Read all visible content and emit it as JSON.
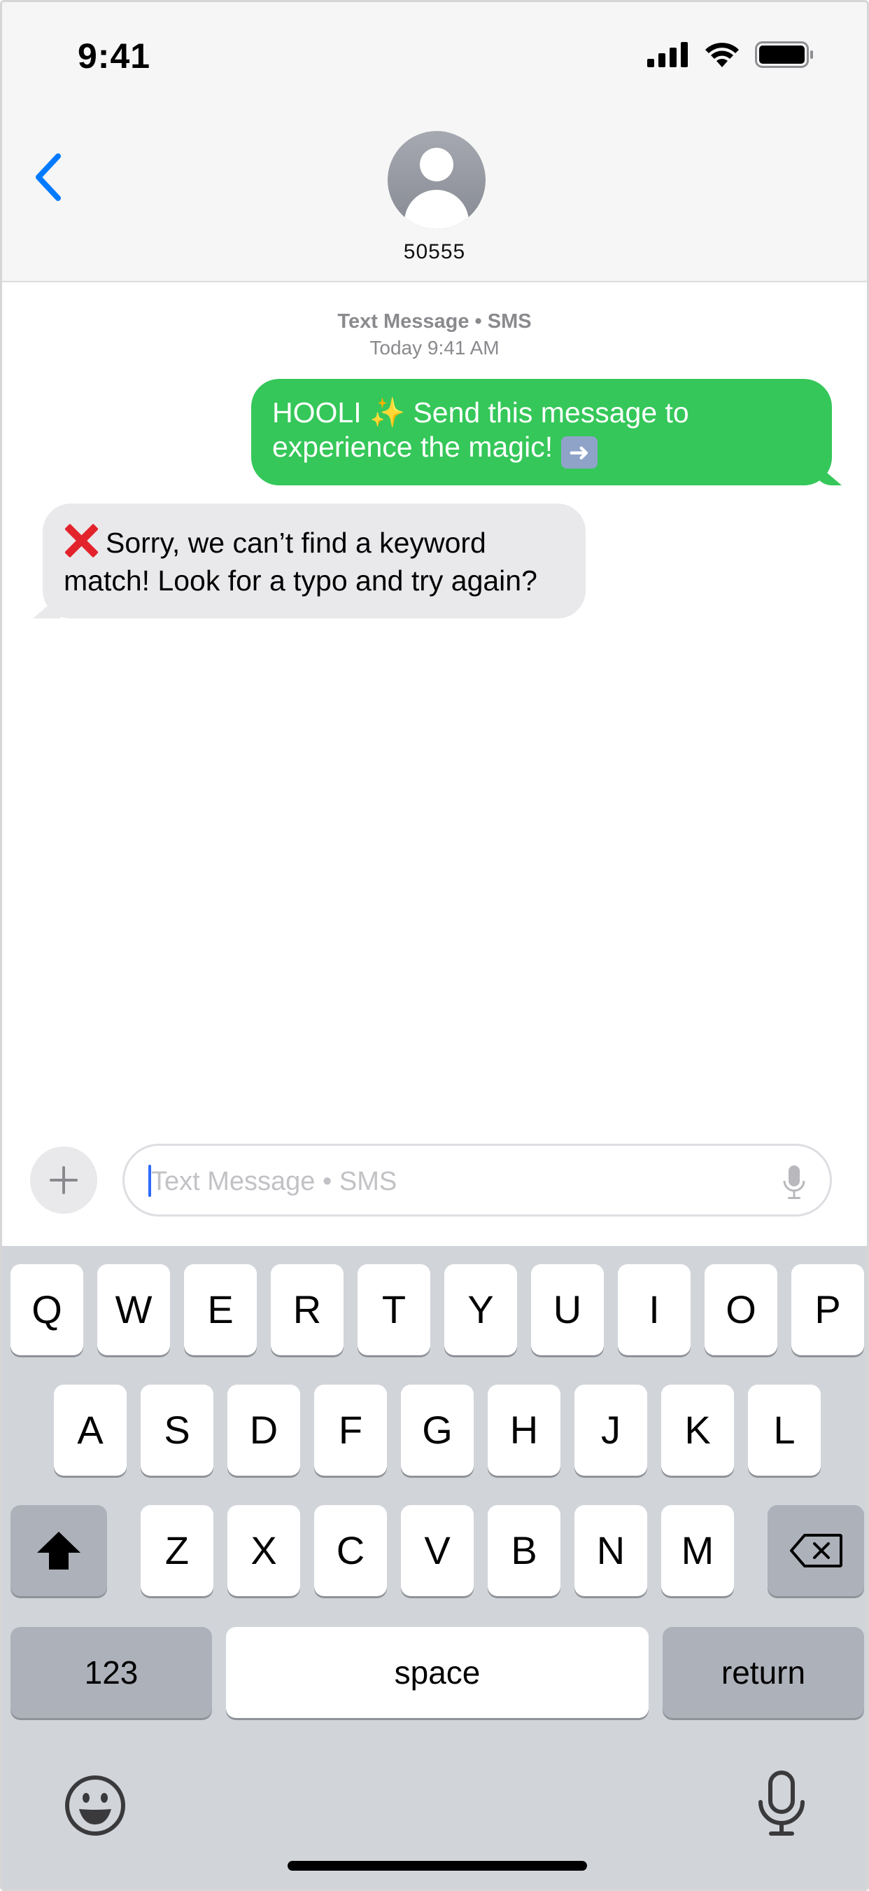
{
  "status_bar": {
    "time": "9:41"
  },
  "header": {
    "contact_name": "50555"
  },
  "conversation": {
    "meta_line1": "Text Message • SMS",
    "meta_line2": "Today 9:41 AM",
    "messages": [
      {
        "direction": "outgoing",
        "text": "HOOLI ✨ Send this message to experience the magic!",
        "trailing_icon": "right-arrow-emoji-icon"
      },
      {
        "direction": "incoming",
        "leading_icon": "cross-mark-emoji-icon",
        "text": "Sorry, we can’t find a keyword match! Look for a typo and try again?"
      }
    ]
  },
  "compose": {
    "placeholder": "Text Message • SMS"
  },
  "keyboard": {
    "row1": [
      "Q",
      "W",
      "E",
      "R",
      "T",
      "Y",
      "U",
      "I",
      "O",
      "P"
    ],
    "row2": [
      "A",
      "S",
      "D",
      "F",
      "G",
      "H",
      "J",
      "K",
      "L"
    ],
    "row3": [
      "Z",
      "X",
      "C",
      "V",
      "B",
      "N",
      "M"
    ],
    "numbers_label": "123",
    "space_label": "space",
    "return_label": "return"
  },
  "colors": {
    "outgoing_bubble": "#35c759",
    "incoming_bubble": "#e9e9eb",
    "accent": "#007aff"
  }
}
